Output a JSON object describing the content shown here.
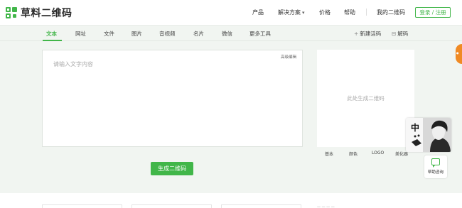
{
  "header": {
    "brand": "草料二维码",
    "nav": [
      "产品",
      "解决方案",
      "价格",
      "帮助"
    ],
    "my_codes": "我的二维码",
    "login": "登录 / 注册"
  },
  "subnav": {
    "tabs": [
      "文本",
      "网址",
      "文件",
      "图片",
      "音视频",
      "名片",
      "微信",
      "更多工具"
    ],
    "active_tab": "文本",
    "new_code": "新建活码",
    "decode": "解码"
  },
  "editor": {
    "advanced": "高级编辑",
    "placeholder": "请输入文字内容"
  },
  "preview": {
    "placeholder": "此处生成二维码",
    "tabs": [
      "基本",
      "颜色",
      "LOGO",
      "美化器"
    ]
  },
  "generate_button": "生成二维码",
  "side": {
    "help": "帮助咨询",
    "popup_char": "中"
  },
  "colors": {
    "accent": "#41b649",
    "handle": "#f08a24"
  }
}
